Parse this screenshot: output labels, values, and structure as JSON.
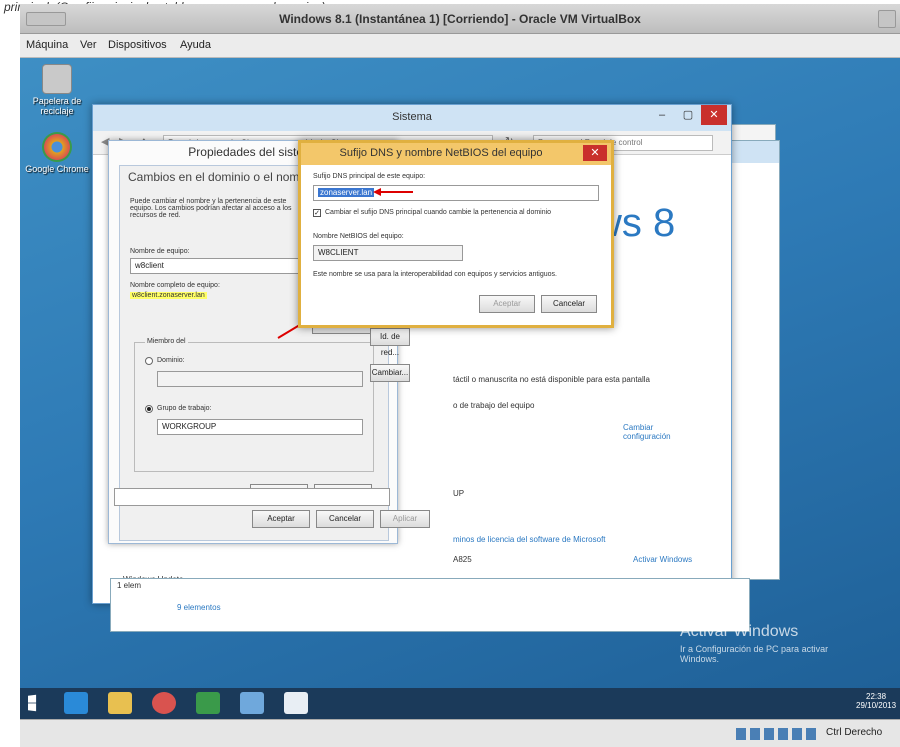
{
  "caption": "principal. (O sufijo principal establecese no nome do equipo)",
  "vbox": {
    "title": "Windows 8.1 (Instantánea 1) [Corriendo] - Oracle VM VirtualBox",
    "menu": [
      "Máquina",
      "Ver",
      "Dispositivos",
      "Ayuda"
    ],
    "status_text": "Ctrl Derecho"
  },
  "desktop": {
    "icons": [
      {
        "label": "Papelera de reciclaje",
        "icon": "recycle-bin-icon",
        "color": "#c0c0c0"
      },
      {
        "label": "Google Chrome",
        "icon": "chrome-icon",
        "color": "#e0a020"
      }
    ],
    "watermark_title": "Activar Windows",
    "watermark_text": "Ir a Configuración de PC para activar Windows."
  },
  "sistema": {
    "title": "Sistema",
    "breadcrumb": "Panel de control  ›  Sistema y seguridad  ›  Sistema",
    "search_placeholder": "Buscar en el Panel de control",
    "win8_logo": "ws 8",
    "pen_text": "táctil o manuscrita no está disponible para esta pantalla",
    "group_text": "o de trabajo del equipo",
    "change_config": "Cambiar configuración",
    "workgroup_suffix": "UP",
    "license_link": "minos de licencia del software de Microsoft",
    "product_id": "A825",
    "activate": "Activar Windows",
    "footer_items": "1 elem",
    "footer_count": "9 elementos",
    "windows_update": "Windows Update"
  },
  "propiedades": {
    "title": "Propiedades del sistema",
    "section_title": "Cambios en el dominio o el nombre del equipo",
    "desc": "Puede cambiar el nombre y la pertenencia de este equipo. Los cambios podrían afectar al acceso a los recursos de red.",
    "computer_name_label": "Nombre de equipo:",
    "computer_name": "w8client",
    "full_name_label": "Nombre completo de equipo:",
    "full_name": "w8client.zonaserver.lan",
    "more_button": "Más...",
    "member_of": "Miembro del",
    "domain_label": "Dominio:",
    "workgroup_label": "Grupo de trabajo:",
    "workgroup": "WORKGROUP",
    "accept": "Aceptar",
    "cancel": "Cancelar",
    "apply": "Aplicar",
    "id_button": "Id. de red...",
    "change_button": "Cambiar..."
  },
  "dns": {
    "title": "Sufijo DNS y nombre NetBIOS del equipo",
    "suffix_label": "Sufijo DNS principal de este equipo:",
    "suffix_value": "zonaserver.lan",
    "checkbox_label": "Cambiar el sufijo DNS principal cuando cambie la pertenencia al dominio",
    "netbios_label": "Nombre NetBIOS del equipo:",
    "netbios_value": "W8CLIENT",
    "note": "Este nombre se usa para la interoperabilidad con equipos y servicios antiguos.",
    "accept": "Aceptar",
    "cancel": "Cancelar"
  },
  "taskbar": {
    "clock_time": "22:38",
    "clock_date": "29/10/2013",
    "apps": [
      {
        "icon": "ie-icon",
        "color": "#2a8ad8"
      },
      {
        "icon": "explorer-icon",
        "color": "#e8c050"
      },
      {
        "icon": "chrome-icon",
        "color": "#d9534f"
      },
      {
        "icon": "store-icon",
        "color": "#3a9a4a"
      },
      {
        "icon": "network-icon",
        "color": "#6fa8dc"
      },
      {
        "icon": "system-icon",
        "color": "#ffffff"
      }
    ]
  }
}
